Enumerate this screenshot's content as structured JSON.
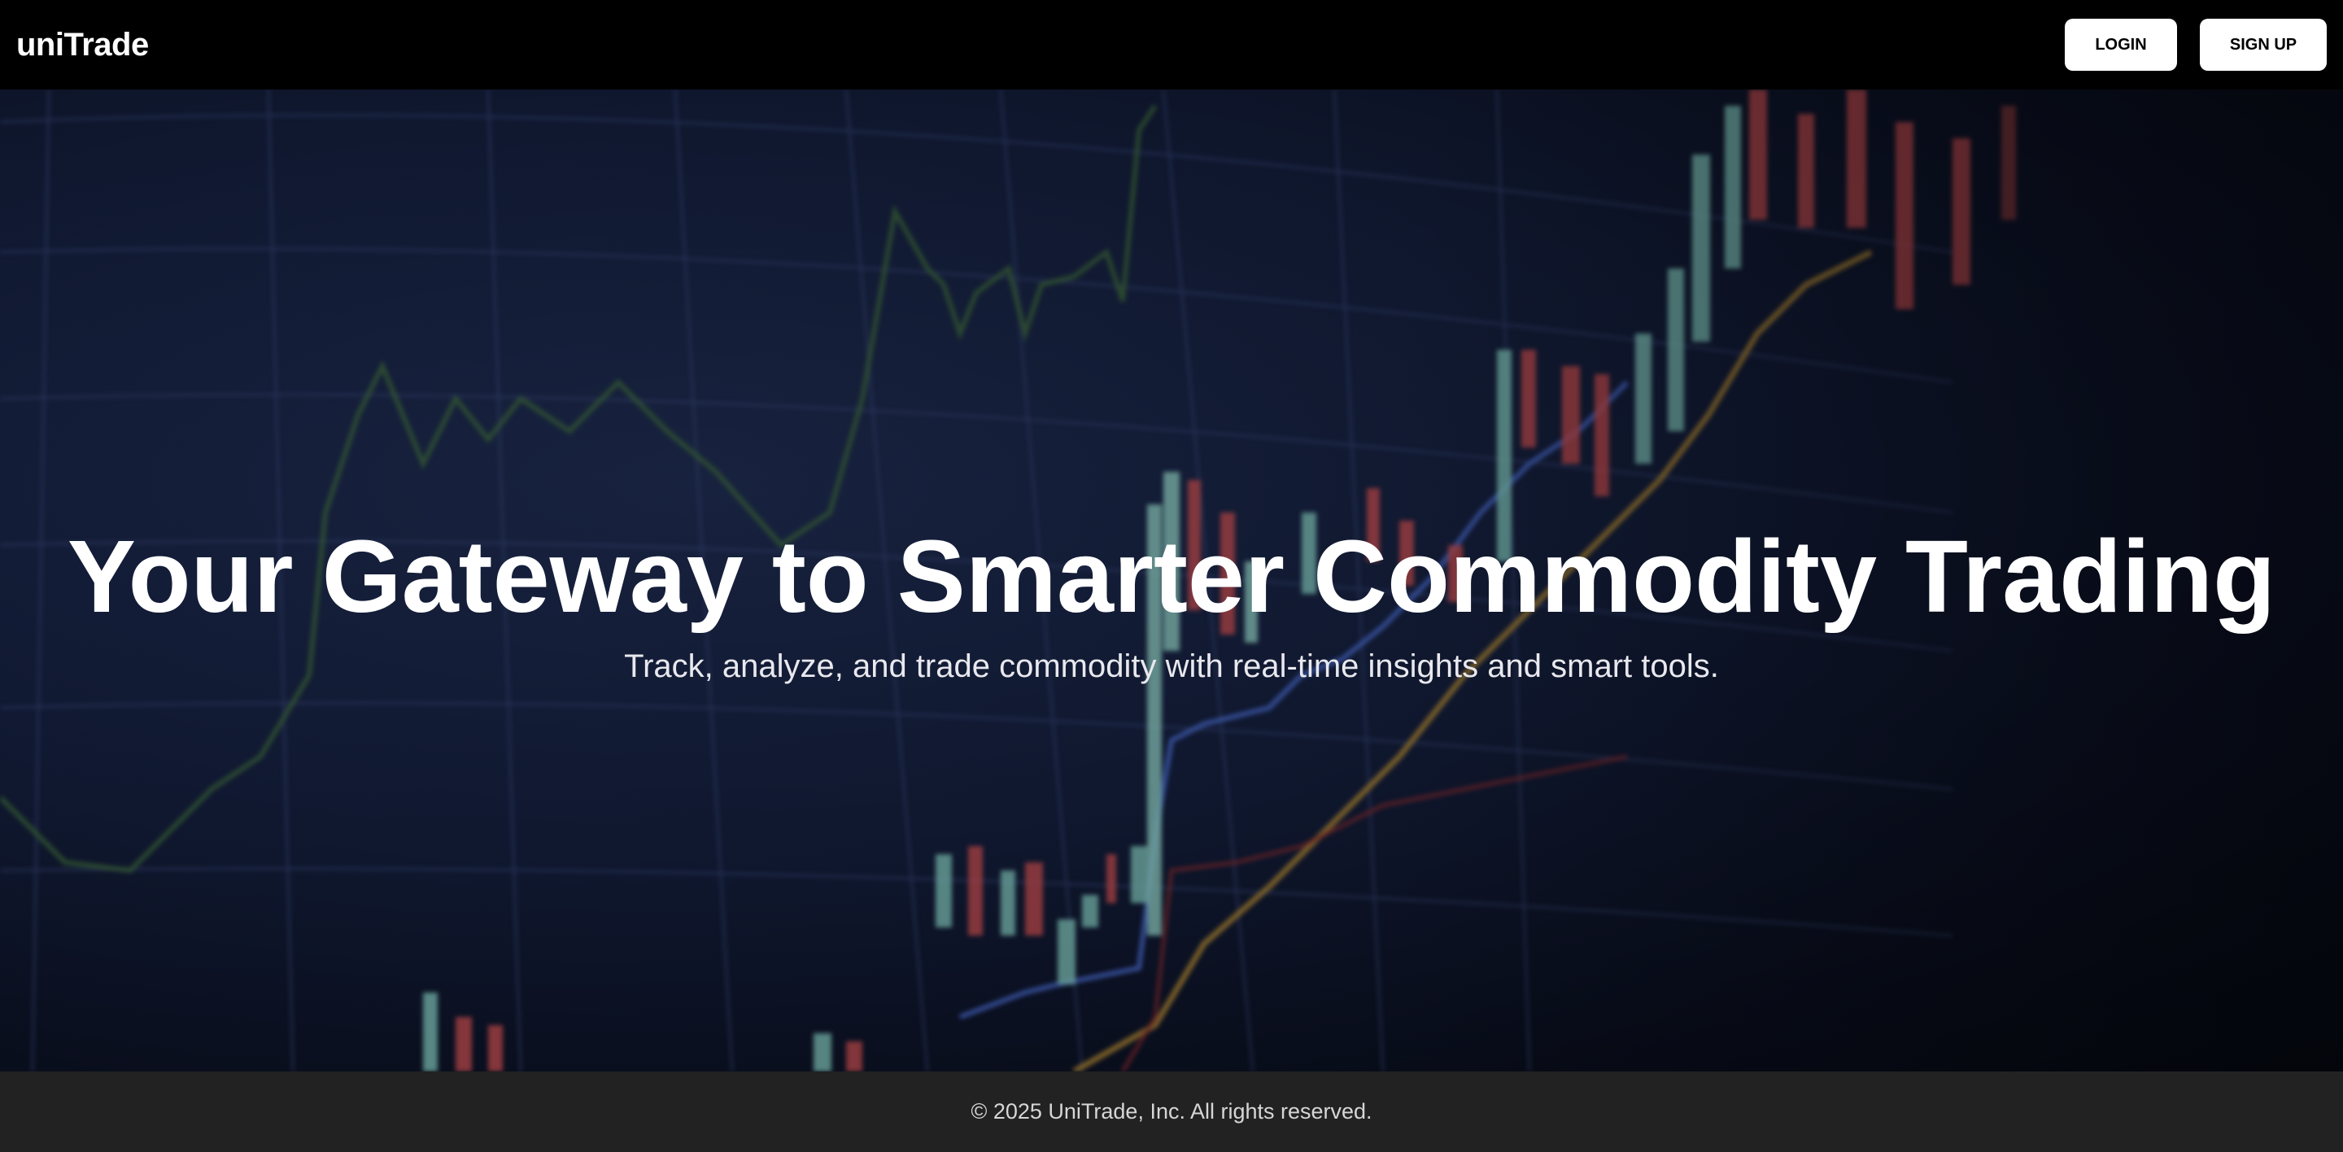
{
  "header": {
    "brand": "uniTrade",
    "login_label": "LOGIN",
    "signup_label": "SIGN UP"
  },
  "hero": {
    "title": "Your Gateway to Smarter Commodity Trading",
    "subtitle": "Track, analyze, and trade commodity with real-time insights and smart tools.",
    "background_image": "trading-chart-background"
  },
  "footer": {
    "copyright": "© 2025 UniTrade, Inc. All rights reserved."
  },
  "colors": {
    "navbar_bg": "#000000",
    "button_bg": "#ffffff",
    "footer_bg": "#222222",
    "hero_bg": "#111a33"
  }
}
